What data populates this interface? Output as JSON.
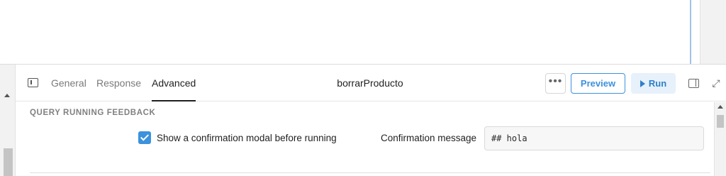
{
  "header": {
    "tabs": [
      {
        "label": "General",
        "active": false
      },
      {
        "label": "Response",
        "active": false
      },
      {
        "label": "Advanced",
        "active": true
      }
    ],
    "query_name": "borrarProducto",
    "more_label": "•••",
    "preview_label": "Preview",
    "run_label": "Run"
  },
  "section": {
    "title": "QUERY RUNNING FEEDBACK",
    "checkbox_label": "Show a confirmation modal before running",
    "checkbox_checked": true,
    "confirmation_label": "Confirmation message",
    "confirmation_value": "## hola"
  },
  "icons": {
    "sidebar_toggle": "sidebar-toggle-icon",
    "run": "play-icon",
    "split": "split-panel-icon",
    "expand": "expand-icon",
    "check": "check-icon"
  },
  "colors": {
    "accent": "#3c92dc",
    "run_bg": "#e6f1fb",
    "run_text": "#2f7fc9"
  }
}
